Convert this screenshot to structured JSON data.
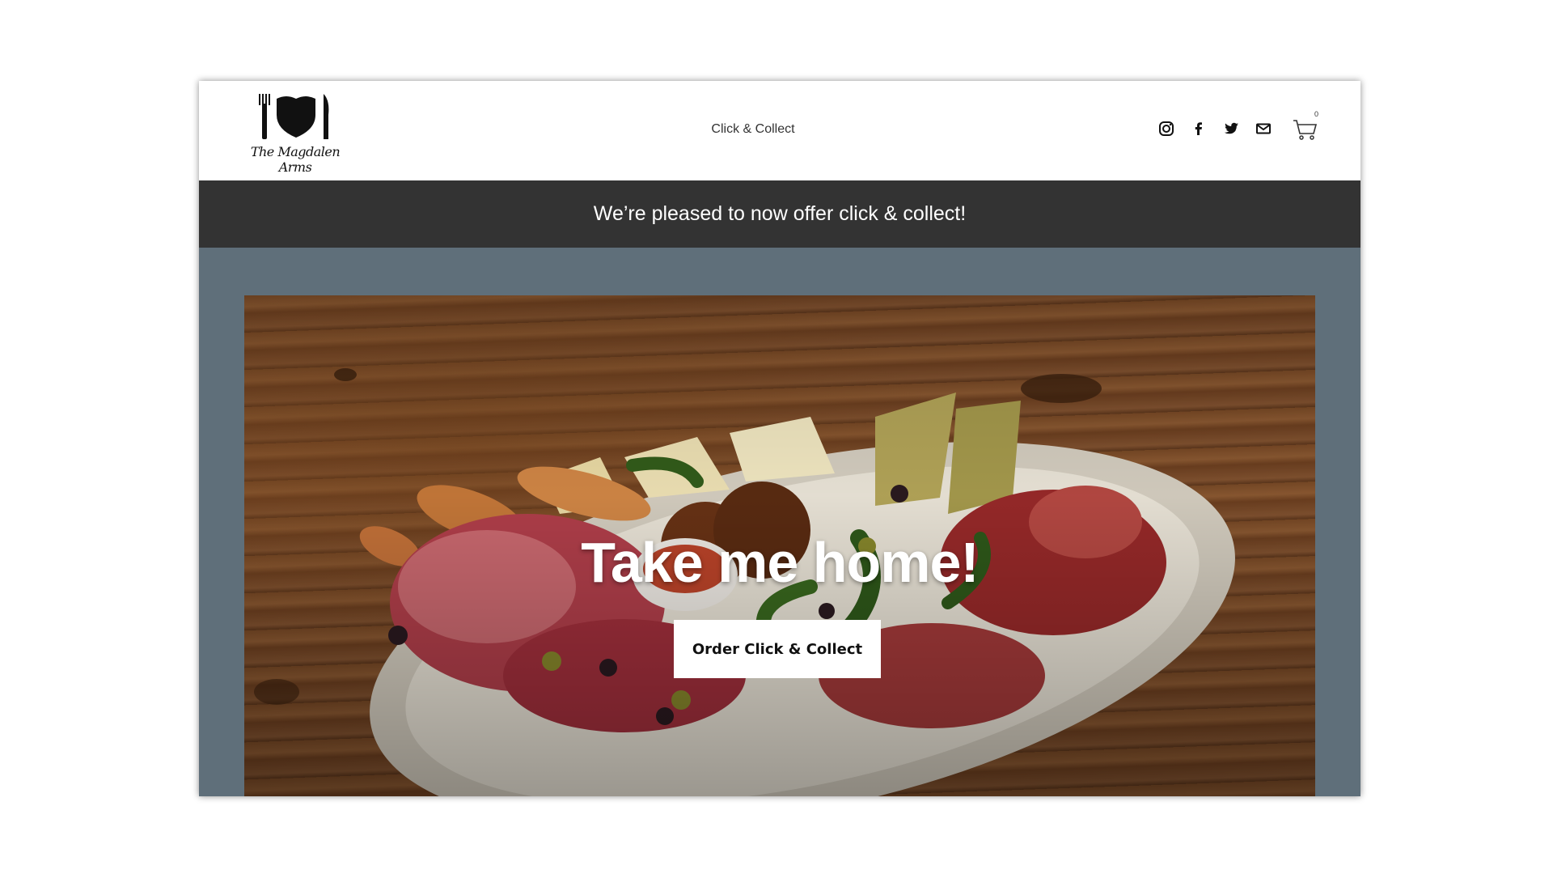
{
  "header": {
    "logo_text": "The Magdalen Arms",
    "nav_link": "Click & Collect",
    "social_icons": [
      "instagram-icon",
      "facebook-icon",
      "twitter-icon",
      "mail-icon"
    ],
    "cart_count": "0"
  },
  "banner": {
    "text": "We’re pleased to now offer click & collect!"
  },
  "hero": {
    "title": "Take me home!",
    "button_label": "Order Click & Collect"
  },
  "colors": {
    "banner_bg": "#333333",
    "page_bg": "#5f6f7a",
    "button_bg": "#ffffff"
  }
}
